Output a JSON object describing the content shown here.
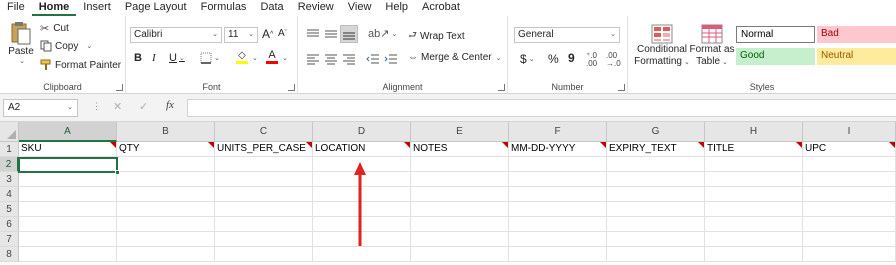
{
  "tabs": [
    "File",
    "Home",
    "Insert",
    "Page Layout",
    "Formulas",
    "Data",
    "Review",
    "View",
    "Help",
    "Acrobat"
  ],
  "active_tab": "Home",
  "clipboard": {
    "paste": "Paste",
    "cut": "Cut",
    "copy": "Copy",
    "format_painter": "Format Painter",
    "label": "Clipboard"
  },
  "font": {
    "name": "Calibri",
    "size": "11",
    "grow": "A",
    "shrink": "A",
    "bold": "B",
    "italic": "I",
    "underline": "U",
    "font_color_letter": "A",
    "fill_color": "#ffff00",
    "font_color": "#ff0000",
    "label": "Font"
  },
  "alignment": {
    "wrap_text": "Wrap Text",
    "merge_center": "Merge & Center",
    "label": "Alignment"
  },
  "number": {
    "format": "General",
    "currency": "$",
    "percent": "%",
    "comma": "9",
    "label": "Number"
  },
  "styles": {
    "conditional_1": "Conditional",
    "conditional_2": "Formatting",
    "format_as_1": "Format as",
    "format_as_2": "Table",
    "normal": "Normal",
    "bad": "Bad",
    "good": "Good",
    "neutral": "Neutral",
    "label": "Styles",
    "colors": {
      "bad_bg": "#ffc7ce",
      "bad_fg": "#9c0006",
      "good_bg": "#c6efce",
      "good_fg": "#006100",
      "neutral_bg": "#ffeb9c",
      "neutral_fg": "#9c5700"
    }
  },
  "formula_bar": {
    "name_box": "A2",
    "cancel": "✕",
    "enter": "✓",
    "fx": "fx",
    "value": ""
  },
  "columns": [
    "A",
    "B",
    "C",
    "D",
    "E",
    "F",
    "G",
    "H",
    "I"
  ],
  "rows": [
    "1",
    "2",
    "3",
    "4",
    "5",
    "6",
    "7",
    "8"
  ],
  "headers": [
    "SKU",
    "QTY",
    "UNITS_PER_CASE",
    "LOCATION",
    "NOTES",
    "MM-DD-YYYY",
    "EXPIRY_TEXT",
    "TITLE",
    "UPC"
  ],
  "selected_cell": "A2",
  "accent_color": "#217346",
  "annotation_color": "#e0231f"
}
